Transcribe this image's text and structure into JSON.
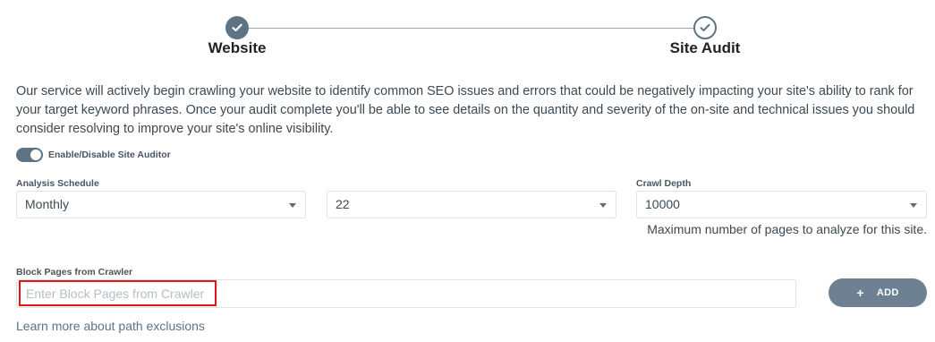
{
  "stepper": {
    "steps": [
      {
        "label": "Website",
        "state": "complete"
      },
      {
        "label": "Site Audit",
        "state": "current"
      }
    ]
  },
  "description": "Our service will actively begin crawling your website to identify common SEO issues and errors that could be negatively impacting your site's ability to rank for your target keyword phrases. Once your audit complete you'll be able to see details on the quantity and severity of the on-site and technical issues you should consider resolving to improve your site's online visibility.",
  "auditor_toggle": {
    "label": "Enable/Disable Site Auditor",
    "enabled": true
  },
  "schedule": {
    "label": "Analysis Schedule",
    "frequency": "Monthly",
    "day": "22"
  },
  "crawl_depth": {
    "label": "Crawl Depth",
    "value": "10000",
    "hint": "Maximum number of pages to analyze for this site."
  },
  "block_pages": {
    "label": "Block Pages from Crawler",
    "placeholder": "Enter Block Pages from Crawler",
    "value": ""
  },
  "add_button": {
    "icon": "plus-icon",
    "label": "ADD"
  },
  "learn_more_link": "Learn more about path exclusions",
  "colors": {
    "accent": "#5e7384",
    "button": "#6d8193",
    "highlight": "#e0141e"
  }
}
